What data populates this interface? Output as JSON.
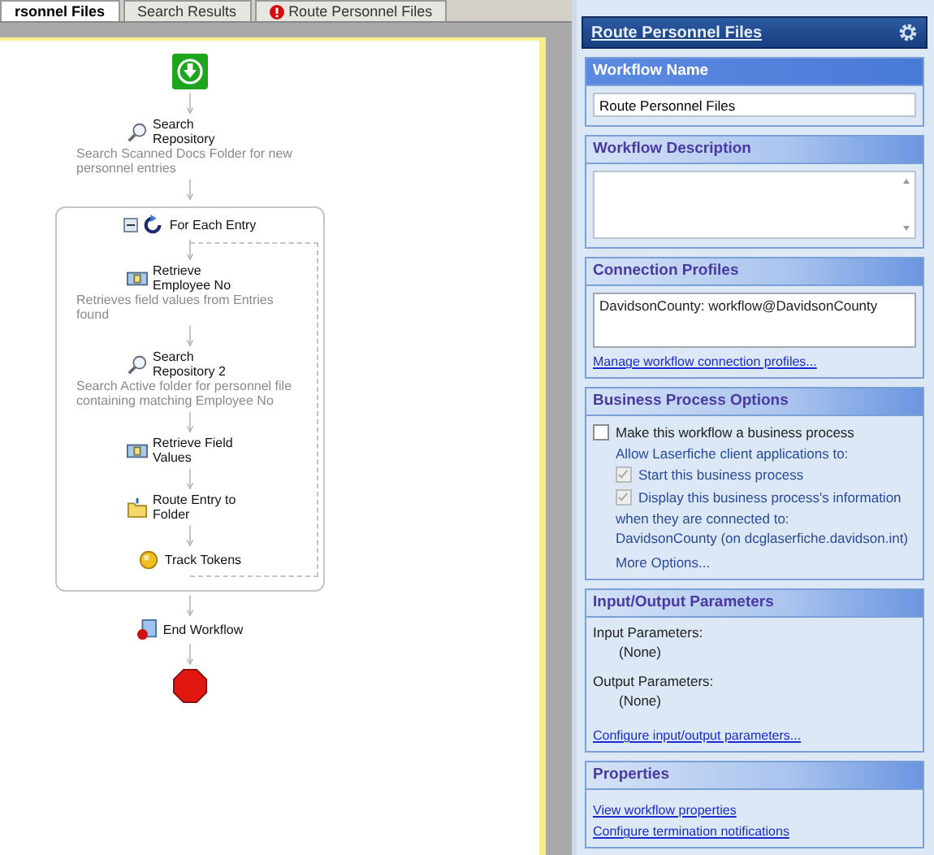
{
  "tabs": [
    {
      "label": "rsonnel Files",
      "selected": true,
      "kind": "plain"
    },
    {
      "label": "Search Results",
      "selected": false,
      "kind": "plain"
    },
    {
      "label": "Route Personnel Files",
      "selected": false,
      "kind": "error"
    }
  ],
  "flow": [
    {
      "kind": "start"
    },
    {
      "kind": "search",
      "title": "Search Repository",
      "description": "Search Scanned Docs Folder for new personnel entries"
    },
    {
      "kind": "loop",
      "title": "For Each Entry",
      "expanded": true,
      "children": [
        {
          "kind": "retrieve",
          "title": "Retrieve Employee No",
          "description": "Retrieves field values from Entries found"
        },
        {
          "kind": "search",
          "title": "Search Repository 2",
          "description": "Search Active folder for personnel file containing matching Employee No"
        },
        {
          "kind": "retrieve",
          "title": "Retrieve Field Values"
        },
        {
          "kind": "route",
          "title": "Route Entry to Folder"
        },
        {
          "kind": "track",
          "title": "Track Tokens"
        }
      ]
    },
    {
      "kind": "end",
      "title": "End Workflow"
    },
    {
      "kind": "stop"
    }
  ],
  "panel": {
    "title": "Route Personnel Files",
    "sections": [
      {
        "kind": "field",
        "title": "Workflow Name",
        "value": "Route Personnel Files"
      },
      {
        "kind": "textarea",
        "title": "Workflow Description"
      },
      {
        "kind": "list",
        "title": "Connection Profiles",
        "items": [
          "DavidsonCounty: workflow@DavidsonCounty"
        ],
        "link": "Manage workflow connection profiles..."
      },
      {
        "kind": "business",
        "title": "Business Process Options",
        "checkbox": {
          "label": "Make this workflow a business process",
          "checked": false
        },
        "note": "Allow Laserfiche client applications to:",
        "options": [
          {
            "label": "Start this business process",
            "checked": true,
            "disabled": true
          },
          {
            "label": "Display this business process's information",
            "checked": true,
            "disabled": true
          }
        ],
        "lines": [
          "when they are connected to:",
          "DavidsonCounty (on dcglaserfiche.davidson.int)"
        ],
        "more": "More Options..."
      },
      {
        "kind": "params",
        "title": "Input/Output Parameters",
        "params": [
          {
            "label": "Input Parameters:",
            "value": "(None)"
          },
          {
            "label": "Output Parameters:",
            "value": "(None)"
          }
        ],
        "link": "Configure input/output parameters..."
      },
      {
        "kind": "links",
        "title": "Properties",
        "links": [
          "View workflow properties",
          "Configure termination notifications"
        ]
      }
    ]
  }
}
